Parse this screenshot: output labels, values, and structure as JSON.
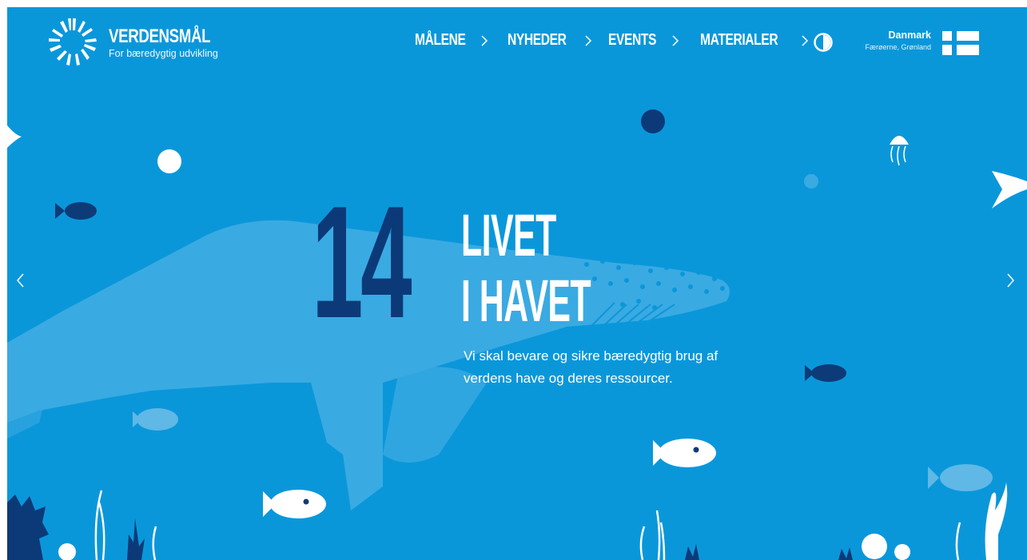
{
  "header": {
    "logo_name": "VERDENSMÅL",
    "logo_tagline": "For bæredygtig udvikling",
    "nav": [
      {
        "label": "MÅLENE"
      },
      {
        "label": "NYHEDER"
      },
      {
        "label": "EVENTS"
      },
      {
        "label": "MATERIALER"
      }
    ],
    "region": {
      "name": "Danmark",
      "sub": "Færøerne, Grønland"
    }
  },
  "hero": {
    "goal_number": "14",
    "title_line1": "LIVET",
    "title_line2": "I HAVET",
    "description": "Vi skal bevare og sikre bæredygtig brug af verdens have og deres ressourcer."
  },
  "icons": {
    "logo": "sdg-wheel-icon",
    "contrast": "contrast-toggle-icon",
    "flag": "nordic-cross-flag-icon",
    "prev": "chevron-left-icon",
    "next": "chevron-right-icon"
  },
  "colors": {
    "background": "#0a97da",
    "goal_number": "#0c3a78",
    "text": "#ffffff",
    "whale": "#3aaae2",
    "fish_dark": "#0d3b78"
  }
}
